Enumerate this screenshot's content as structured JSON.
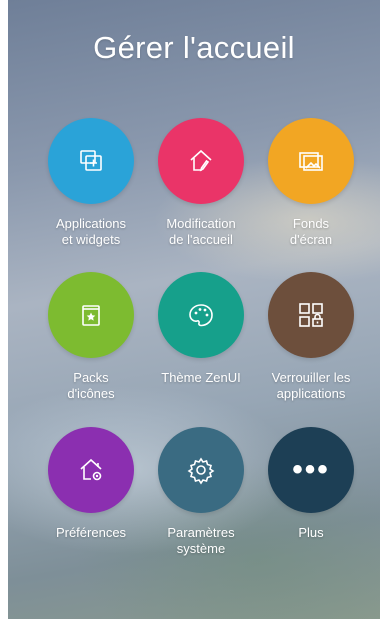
{
  "header": {
    "title": "Gérer l'accueil"
  },
  "tiles": [
    {
      "label": "Applications\net widgets",
      "color": "#2aa3d8",
      "icon": "app-widget-icon"
    },
    {
      "label": "Modification\nde l'accueil",
      "color": "#ea3468",
      "icon": "home-edit-icon"
    },
    {
      "label": "Fonds\nd'écran",
      "color": "#f2a623",
      "icon": "wallpaper-icon"
    },
    {
      "label": "Packs\nd'icônes",
      "color": "#7dbb30",
      "icon": "icon-pack-icon"
    },
    {
      "label": "Thème ZenUI",
      "color": "#16a08b",
      "icon": "palette-icon"
    },
    {
      "label": "Verrouiller les\napplications",
      "color": "#6d4f3c",
      "icon": "app-lock-icon"
    },
    {
      "label": "Préférences",
      "color": "#8b2fb0",
      "icon": "home-settings-icon"
    },
    {
      "label": "Paramètres\nsystème",
      "color": "#3a6b82",
      "icon": "gear-icon"
    },
    {
      "label": "Plus",
      "color": "#1d3f55",
      "icon": "more-dots-icon"
    }
  ]
}
